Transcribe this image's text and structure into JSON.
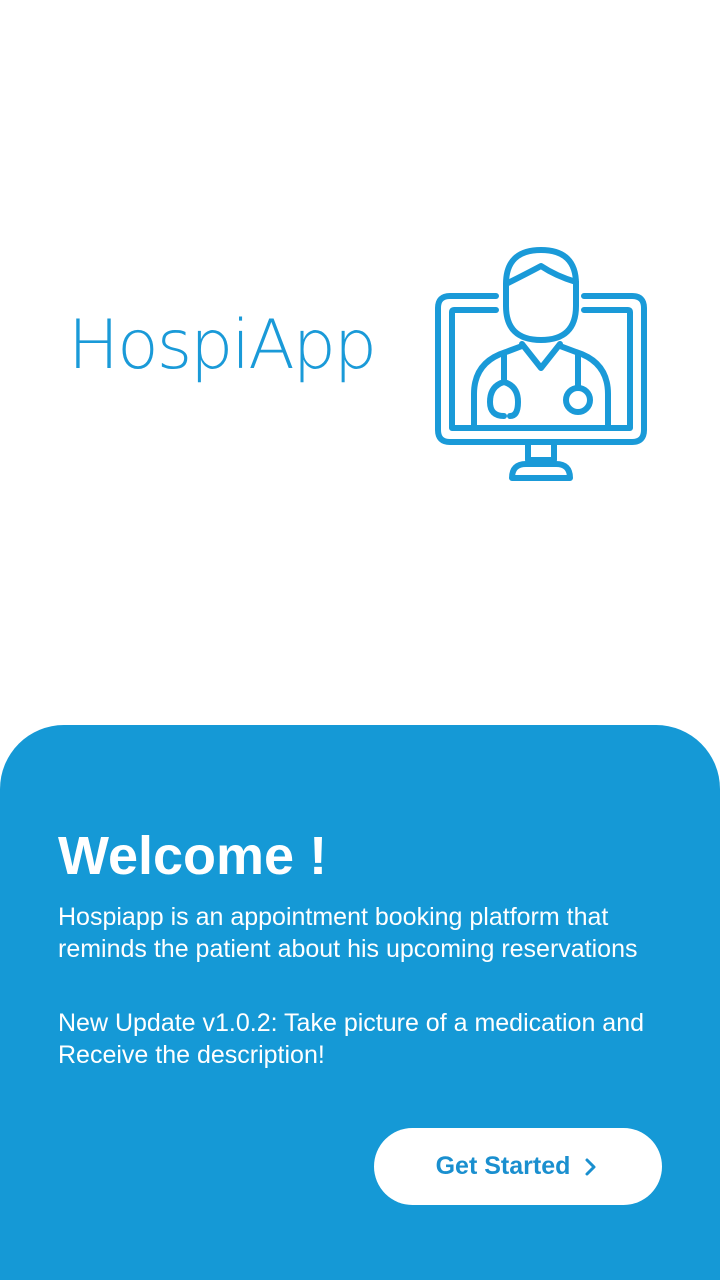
{
  "logo": {
    "brand_name": "HospiApp",
    "icon": "doctor-monitor-icon",
    "brand_color": "#1a9ad8"
  },
  "welcome": {
    "title": "Welcome !",
    "description": "Hospiapp is an appointment booking platform that reminds the patient about his upcoming reservations",
    "update_note": "New Update v1.0.2: Take picture of a medication and Receive the description!",
    "panel_color": "#1599d6"
  },
  "cta": {
    "label": "Get Started",
    "icon": "chevron-right-icon"
  }
}
